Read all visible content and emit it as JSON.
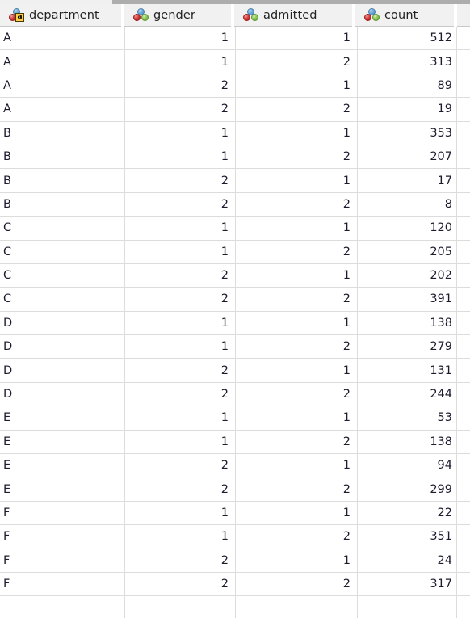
{
  "window": {
    "type": "data-grid",
    "scrollbar": {
      "orientation": "horizontal",
      "position": "top"
    }
  },
  "columns": [
    {
      "id": "department",
      "label": "department",
      "icon": "nominal-string-measure-icon",
      "measure": "nominal",
      "datatype": "string",
      "align": "left"
    },
    {
      "id": "gender",
      "label": "gender",
      "icon": "nominal-measure-icon",
      "measure": "nominal",
      "datatype": "numeric",
      "align": "right"
    },
    {
      "id": "admitted",
      "label": "admitted",
      "icon": "nominal-measure-icon",
      "measure": "nominal",
      "datatype": "numeric",
      "align": "right"
    },
    {
      "id": "count",
      "label": "count",
      "icon": "nominal-measure-icon",
      "measure": "nominal",
      "datatype": "numeric",
      "align": "right"
    }
  ],
  "rows": [
    {
      "department": "A",
      "gender": "1",
      "admitted": "1",
      "count": "512"
    },
    {
      "department": "A",
      "gender": "1",
      "admitted": "2",
      "count": "313"
    },
    {
      "department": "A",
      "gender": "2",
      "admitted": "1",
      "count": "89"
    },
    {
      "department": "A",
      "gender": "2",
      "admitted": "2",
      "count": "19"
    },
    {
      "department": "B",
      "gender": "1",
      "admitted": "1",
      "count": "353"
    },
    {
      "department": "B",
      "gender": "1",
      "admitted": "2",
      "count": "207"
    },
    {
      "department": "B",
      "gender": "2",
      "admitted": "1",
      "count": "17"
    },
    {
      "department": "B",
      "gender": "2",
      "admitted": "2",
      "count": "8"
    },
    {
      "department": "C",
      "gender": "1",
      "admitted": "1",
      "count": "120"
    },
    {
      "department": "C",
      "gender": "1",
      "admitted": "2",
      "count": "205"
    },
    {
      "department": "C",
      "gender": "2",
      "admitted": "1",
      "count": "202"
    },
    {
      "department": "C",
      "gender": "2",
      "admitted": "2",
      "count": "391"
    },
    {
      "department": "D",
      "gender": "1",
      "admitted": "1",
      "count": "138"
    },
    {
      "department": "D",
      "gender": "1",
      "admitted": "2",
      "count": "279"
    },
    {
      "department": "D",
      "gender": "2",
      "admitted": "1",
      "count": "131"
    },
    {
      "department": "D",
      "gender": "2",
      "admitted": "2",
      "count": "244"
    },
    {
      "department": "E",
      "gender": "1",
      "admitted": "1",
      "count": "53"
    },
    {
      "department": "E",
      "gender": "1",
      "admitted": "2",
      "count": "138"
    },
    {
      "department": "E",
      "gender": "2",
      "admitted": "1",
      "count": "94"
    },
    {
      "department": "E",
      "gender": "2",
      "admitted": "2",
      "count": "299"
    },
    {
      "department": "F",
      "gender": "1",
      "admitted": "1",
      "count": "22"
    },
    {
      "department": "F",
      "gender": "1",
      "admitted": "2",
      "count": "351"
    },
    {
      "department": "F",
      "gender": "2",
      "admitted": "1",
      "count": "24"
    },
    {
      "department": "F",
      "gender": "2",
      "admitted": "2",
      "count": "317"
    }
  ],
  "colors": {
    "header_bg": "#f1f1f1",
    "grid_line": "#dcdcdc",
    "text": "#1c1c2e",
    "scrollbar_thumb": "#adadad",
    "scrollbar_track": "#f0f0f0",
    "icon_blue": "#74aede",
    "icon_red": "#d43c3c",
    "icon_green": "#8ec85a",
    "badge_yellow": "#ffd24a"
  }
}
